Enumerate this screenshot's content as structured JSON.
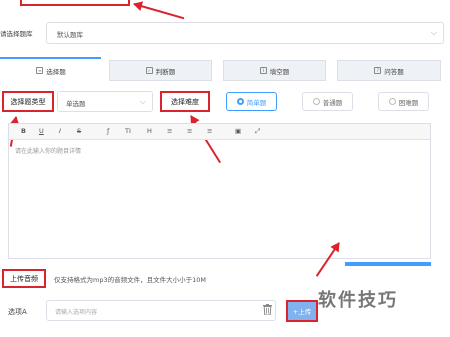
{
  "bank": {
    "label": "请选择题库",
    "value": "默认题库"
  },
  "tabs": [
    {
      "label": "选择题",
      "icon": "list-icon"
    },
    {
      "label": "判断题",
      "icon": "check-icon"
    },
    {
      "label": "填空题",
      "icon": "blank-icon"
    },
    {
      "label": "问答题",
      "icon": "qa-icon"
    }
  ],
  "question_type": {
    "label": "选择题类型",
    "value": "单选题"
  },
  "difficulty": {
    "label": "选择难度",
    "options": [
      {
        "label": "简单题",
        "selected": true
      },
      {
        "label": "普通题",
        "selected": false
      },
      {
        "label": "困难题",
        "selected": false
      }
    ]
  },
  "editor": {
    "toolbar": [
      "B",
      "U",
      "I",
      "S",
      "ƒ",
      "TI",
      "H",
      "≡",
      "≡",
      "≡",
      "▣",
      "⤢"
    ],
    "placeholder": "请在此输入你的题目详情"
  },
  "upload": {
    "label": "上传音频",
    "hint": "仅支持格式为mp3的音频文件，且文件大小小于10M"
  },
  "option_a": {
    "label": "选项A",
    "placeholder": "请输入选项内容",
    "button_label": "+上传"
  },
  "watermark": "软件技巧",
  "colors": {
    "accent": "#409eff",
    "highlight": "#d9232d"
  }
}
